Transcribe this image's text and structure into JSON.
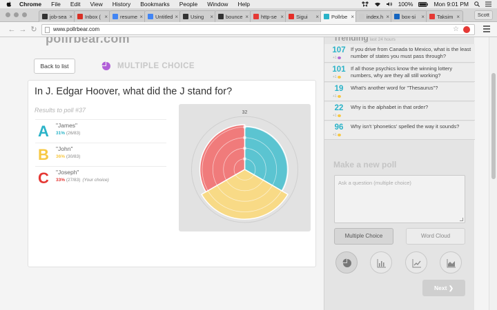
{
  "menubar": {
    "app": "Chrome",
    "items": [
      "File",
      "Edit",
      "View",
      "History",
      "Bookmarks",
      "People",
      "Window",
      "Help"
    ],
    "battery": "100%",
    "clock": "Mon 9:01 PM"
  },
  "browser": {
    "tabs": [
      {
        "title": "job-sea",
        "color": "#333333"
      },
      {
        "title": "Inbox (",
        "color": "#d93025"
      },
      {
        "title": "resume",
        "color": "#4285f4"
      },
      {
        "title": "Untitled",
        "color": "#4285f4"
      },
      {
        "title": "Using",
        "color": "#333333"
      },
      {
        "title": "bounce",
        "color": "#333333"
      },
      {
        "title": "http-se",
        "color": "#e53935"
      },
      {
        "title": "Sigui",
        "color": "#e52d27"
      },
      {
        "title": "Pollrbe",
        "color": "#2ab3c8"
      },
      {
        "title": "index.h",
        "color": "#cccccc"
      },
      {
        "title": "box-si",
        "color": "#1565c0"
      },
      {
        "title": "Taksim",
        "color": "#e53935"
      }
    ],
    "profile": "Scott",
    "url": "www.pollrbear.com"
  },
  "page": {
    "logo": "pollrbear.com",
    "back_label": "Back to list",
    "poll_type": "MULTIPLE CHOICE",
    "question": "In J. Edgar Hoover, what did the J stand for?",
    "results_title": "Results to poll #37",
    "choices": [
      {
        "letter": "A",
        "name": "\"James\"",
        "percent": "31%",
        "count": "(26/83)",
        "note": "",
        "color": "#2ab3c8"
      },
      {
        "letter": "B",
        "name": "\"John\"",
        "percent": "36%",
        "count": "(30/83)",
        "note": "",
        "color": "#f7c843"
      },
      {
        "letter": "C",
        "name": "\"Joseph\"",
        "percent": "33%",
        "count": "(27/83)",
        "note": "(Your choice)",
        "color": "#e53935"
      }
    ]
  },
  "chart_data": {
    "type": "polar-area",
    "categories": [
      "James",
      "John",
      "Joseph"
    ],
    "values": [
      26,
      30,
      27
    ],
    "colors": [
      "#5bc4d1",
      "#f8da86",
      "#f07b7b"
    ],
    "rmax": 32,
    "tick_labels": [
      "32"
    ]
  },
  "sidebar": {
    "trending_title": "Trending",
    "trending_sub": "last 24 hours",
    "trending": [
      {
        "count": "107",
        "question": "If you drive from Canada to Mexico, what is the least number of states you must pass through?",
        "dot": "#b06bd6"
      },
      {
        "count": "101",
        "question": "If all those psychics know the winning lottery numbers, why are they all still working?",
        "dot": "#f7c843"
      },
      {
        "count": "19",
        "question": "What's another word for \"Thesaurus\"?",
        "dot": "#f7c843"
      },
      {
        "count": "22",
        "question": "Why is the alphabet in that order?",
        "dot": "#f7c843"
      },
      {
        "count": "96",
        "question": "Why isn't 'phonetics' spelled the way it sounds?",
        "dot": "#f7c843"
      }
    ],
    "new_poll_title": "Make a new poll",
    "input_placeholder": "Ask a question (multiple choice)",
    "type_multiple": "Multiple Choice",
    "type_cloud": "Word Cloud",
    "chart_icons": [
      "pie-chart-icon",
      "bar-chart-icon",
      "line-chart-icon",
      "area-chart-icon"
    ],
    "next_label": "Next"
  }
}
